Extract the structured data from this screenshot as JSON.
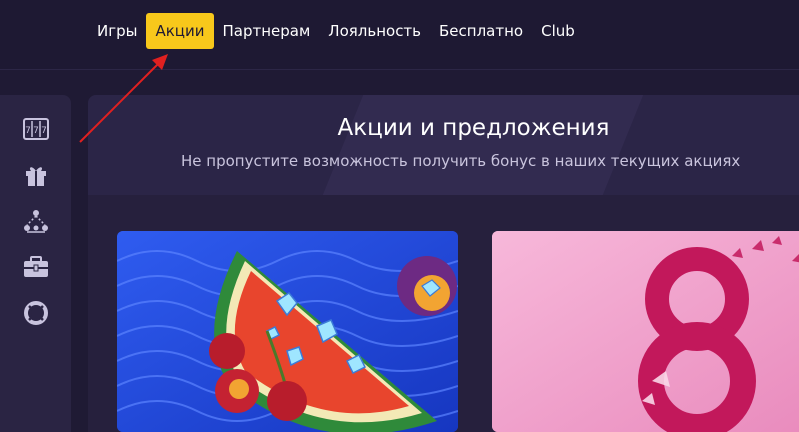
{
  "nav": {
    "items": [
      {
        "label": "Игры",
        "active": false
      },
      {
        "label": "Акции",
        "active": true
      },
      {
        "label": "Партнерам",
        "active": false
      },
      {
        "label": "Лояльность",
        "active": false
      },
      {
        "label": "Бесплатно",
        "active": false
      },
      {
        "label": "Club",
        "active": false
      }
    ]
  },
  "sidebar": {
    "icons": [
      "slot-machine-icon",
      "gift-icon",
      "network-icon",
      "briefcase-icon",
      "lifebuoy-icon"
    ]
  },
  "hero": {
    "title": "Акции и предложения",
    "subtitle": "Не пропустите возможность получить бонус в наших текущих акциях"
  },
  "cards": [
    {
      "name": "watermelon-promo",
      "background": "#1f45d8"
    },
    {
      "name": "march-8-promo",
      "background": "#f0a8cf"
    }
  ],
  "colors": {
    "accent": "#f8c81b",
    "background": "#1f1a34",
    "annotation": "#e02020"
  }
}
